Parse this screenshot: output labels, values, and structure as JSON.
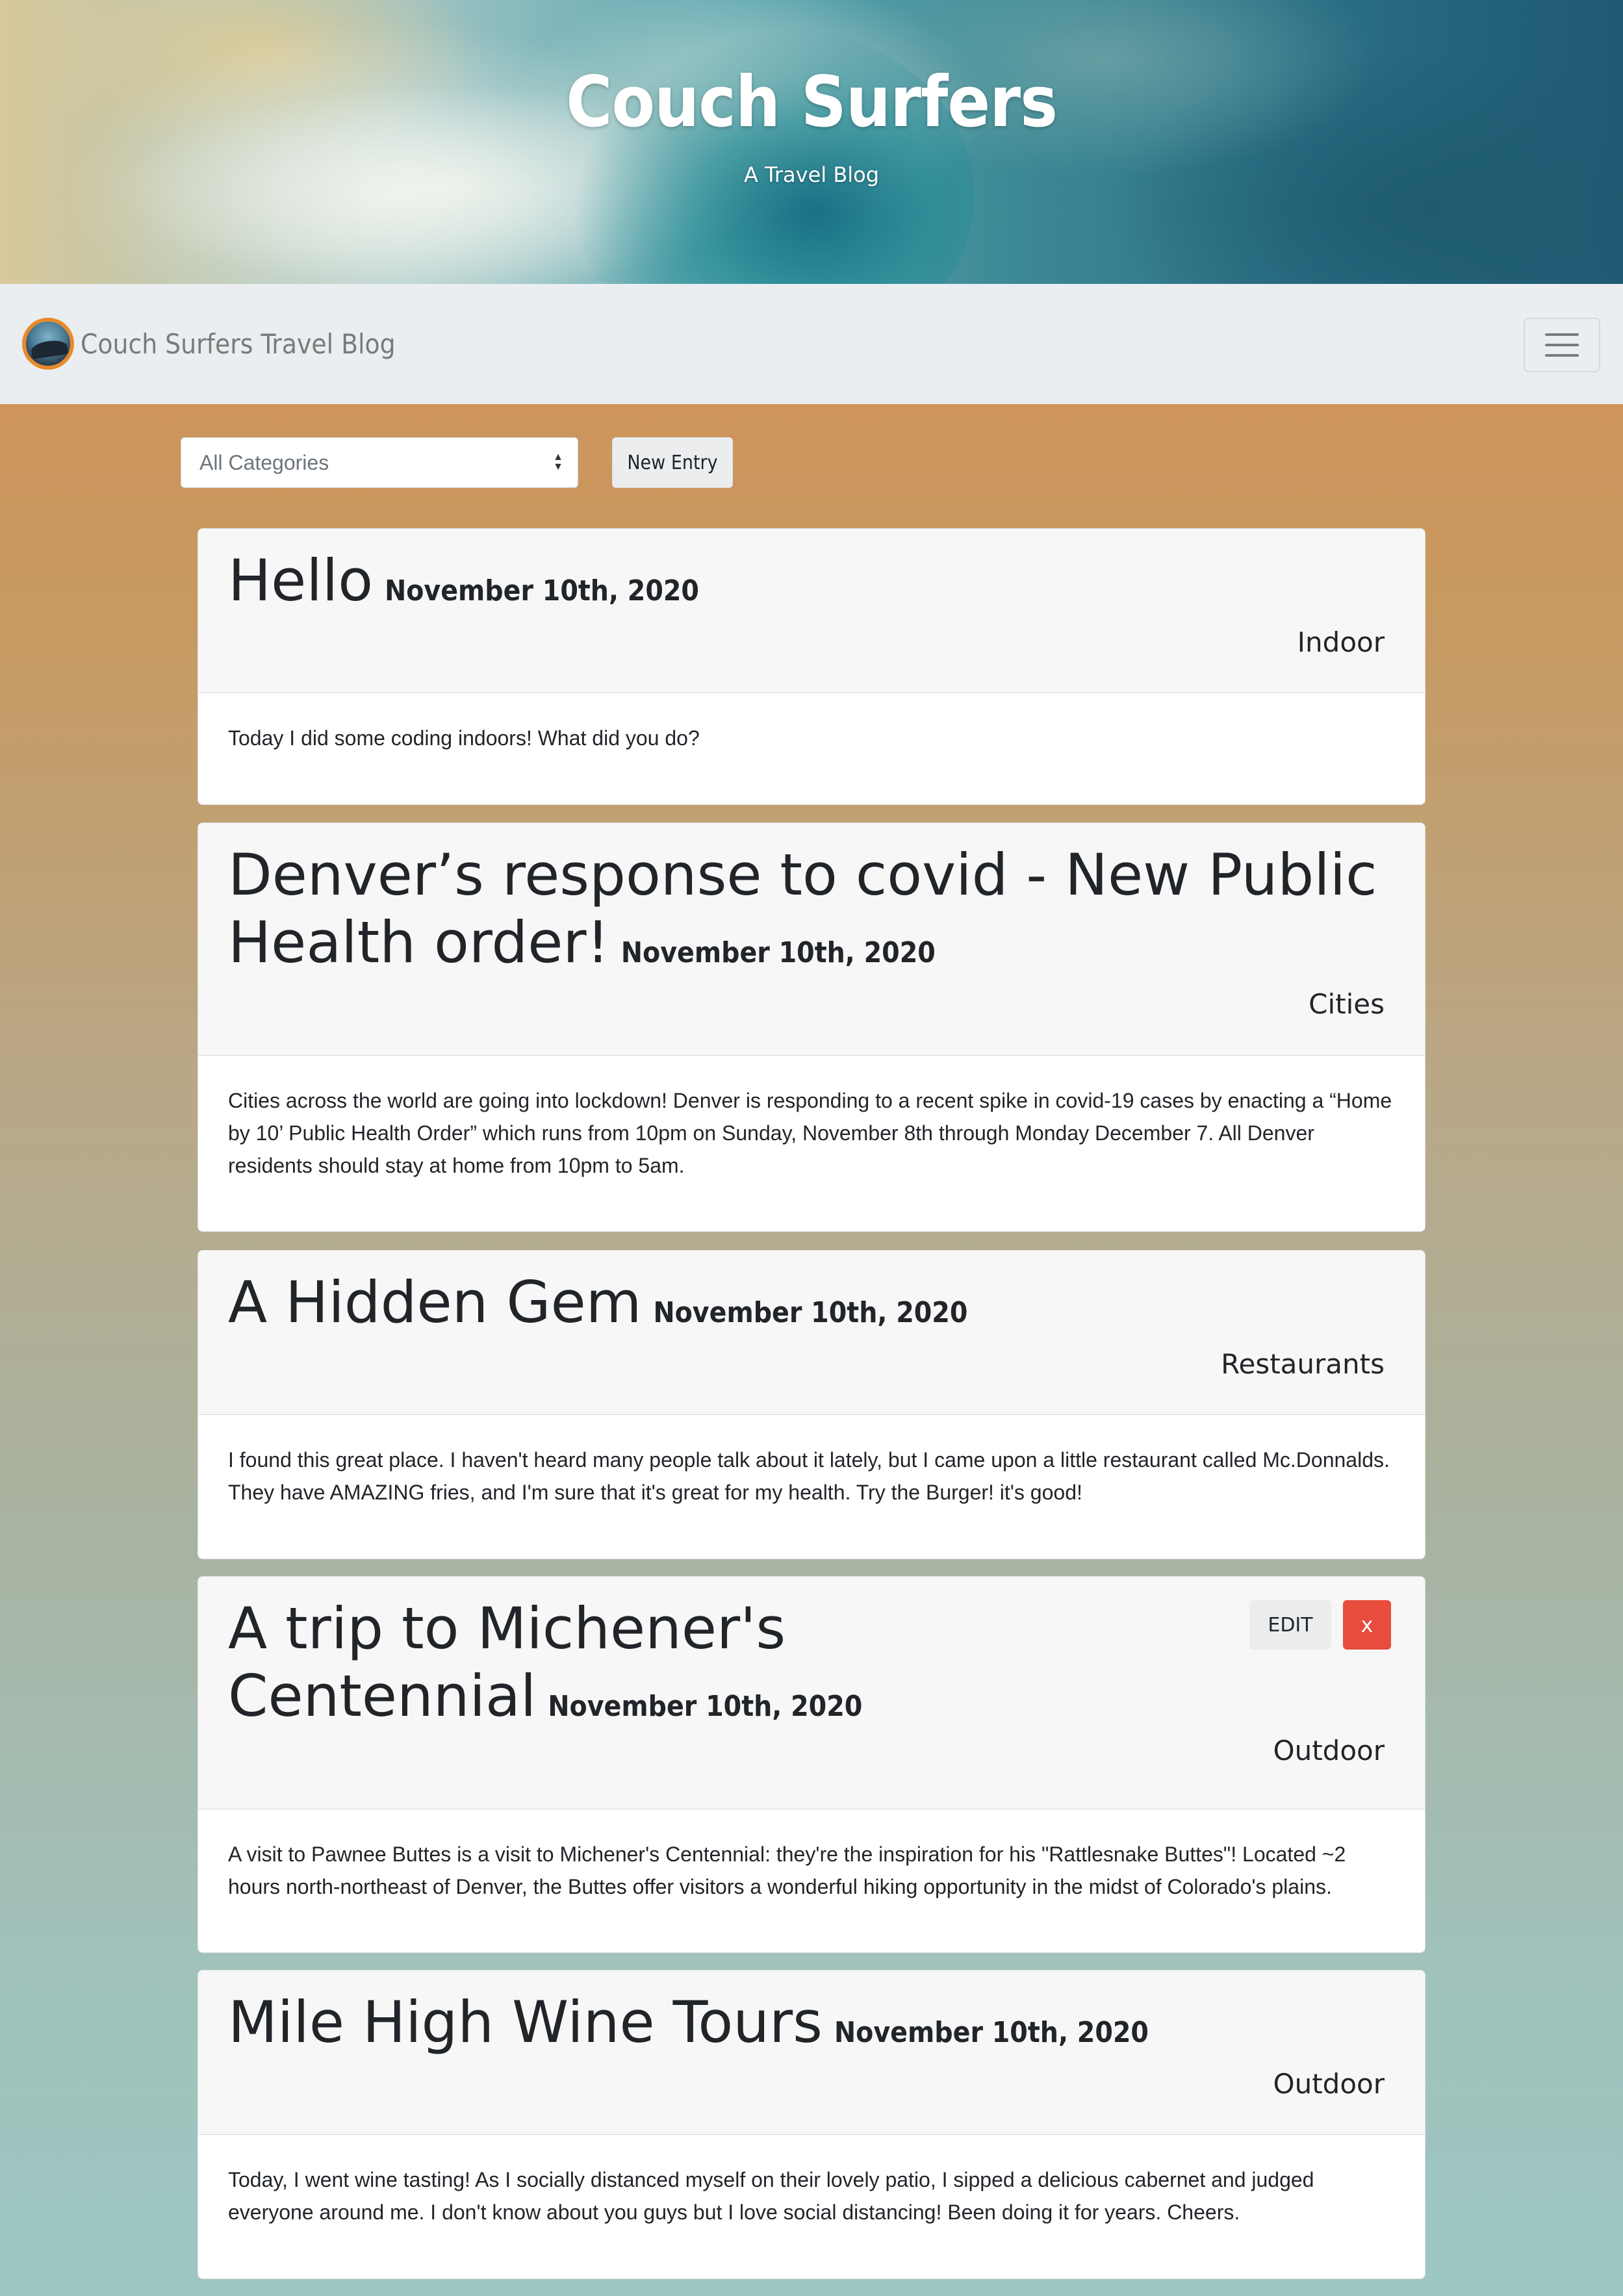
{
  "hero": {
    "title": "Couch Surfers",
    "subtitle": "A Travel Blog"
  },
  "navbar": {
    "brand": "Couch Surfers Travel Blog"
  },
  "controls": {
    "category_select_value": "All Categories",
    "new_entry_label": "New Entry"
  },
  "posts": [
    {
      "title": "Hello",
      "date": "November 10th, 2020",
      "category": "Indoor",
      "body": "Today I did some coding indoors! What did you do?"
    },
    {
      "title": "Denver’s response to covid - New Public Health order!",
      "date": "November 10th, 2020",
      "category": "Cities",
      "body": "Cities across the world are going into lockdown! Denver is responding to a recent spike in covid-19 cases by enacting a “Home by 10’ Public Health Order” which runs from 10pm on Sunday, November 8th through Monday December 7. All Denver residents should stay at home from 10pm to 5am."
    },
    {
      "title": "A Hidden Gem",
      "date": "November 10th, 2020",
      "category": "Restaurants",
      "body": "I found this great place. I haven't heard many people talk about it lately, but I came upon a little restaurant called Mc.Donnalds. They have AMAZING fries, and I'm sure that it's great for my health. Try the Burger! it's good!"
    },
    {
      "title": "A trip to Michener's Centennial",
      "date": "November 10th, 2020",
      "category": "Outdoor",
      "body": "A visit to Pawnee Buttes is a visit to Michener's Centennial: they're the inspiration for his \"Rattlesnake Buttes\"! Located ~2 hours north-northeast of Denver, the Buttes offer visitors a wonderful hiking opportunity in the midst of Colorado's plains.",
      "edit_label": "EDIT",
      "delete_label": "x"
    },
    {
      "title": "Mile High Wine Tours",
      "date": "November 10th, 2020",
      "category": "Outdoor",
      "body": "Today, I went wine tasting! As I socially distanced myself on their lovely patio, I sipped a delicious cabernet and judged everyone around me. I don't know about you guys but I love social distancing! Been doing it for years. Cheers."
    }
  ]
}
